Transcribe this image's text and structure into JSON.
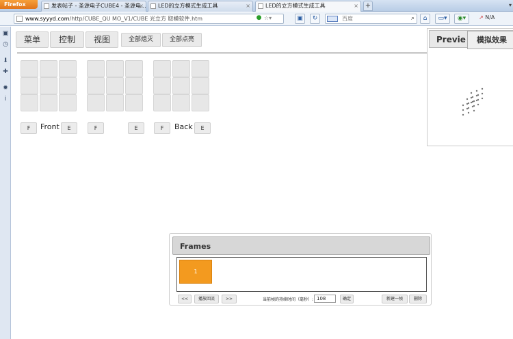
{
  "browser": {
    "app_button": "Firefox",
    "tabs": [
      {
        "label": "发表帖子 - 圣源电子CUBE4 - 圣源电..."
      },
      {
        "label": "LED的立方模式生成工具"
      },
      {
        "label": "LED的立方模式生成工具"
      }
    ],
    "new_tab": "+",
    "url_domain": "www.syyyd.com",
    "url_path": "/http/CUBE_QU MO_V1/CUBE 光立方 取模软件.htm",
    "search_placeholder": "百度",
    "na_label": "N/A"
  },
  "toolbar": {
    "menu": "菜单",
    "control": "控制",
    "view": "视图",
    "all_off": "全部熄灭",
    "all_on": "全部点亮"
  },
  "faces": {
    "front_label": "Front",
    "back_label": "Back",
    "f_btn": "F",
    "e_btn": "E"
  },
  "preview": {
    "title": "Previe",
    "sim_tab": "模拟效果"
  },
  "frames": {
    "title": "Frames",
    "items": [
      {
        "label": "1"
      }
    ],
    "prev_btn": "<<",
    "play_btn": "播放回流",
    "next_btn": ">>",
    "interval_label": "当前帧的持续时间（毫秒）:",
    "interval_value": "108",
    "confirm_btn": "确定",
    "new_frame_btn": "新建一帧",
    "delete_btn": "删除"
  },
  "colors": {
    "frame_active": "#f39a1f",
    "firefox": "#e2741a"
  }
}
